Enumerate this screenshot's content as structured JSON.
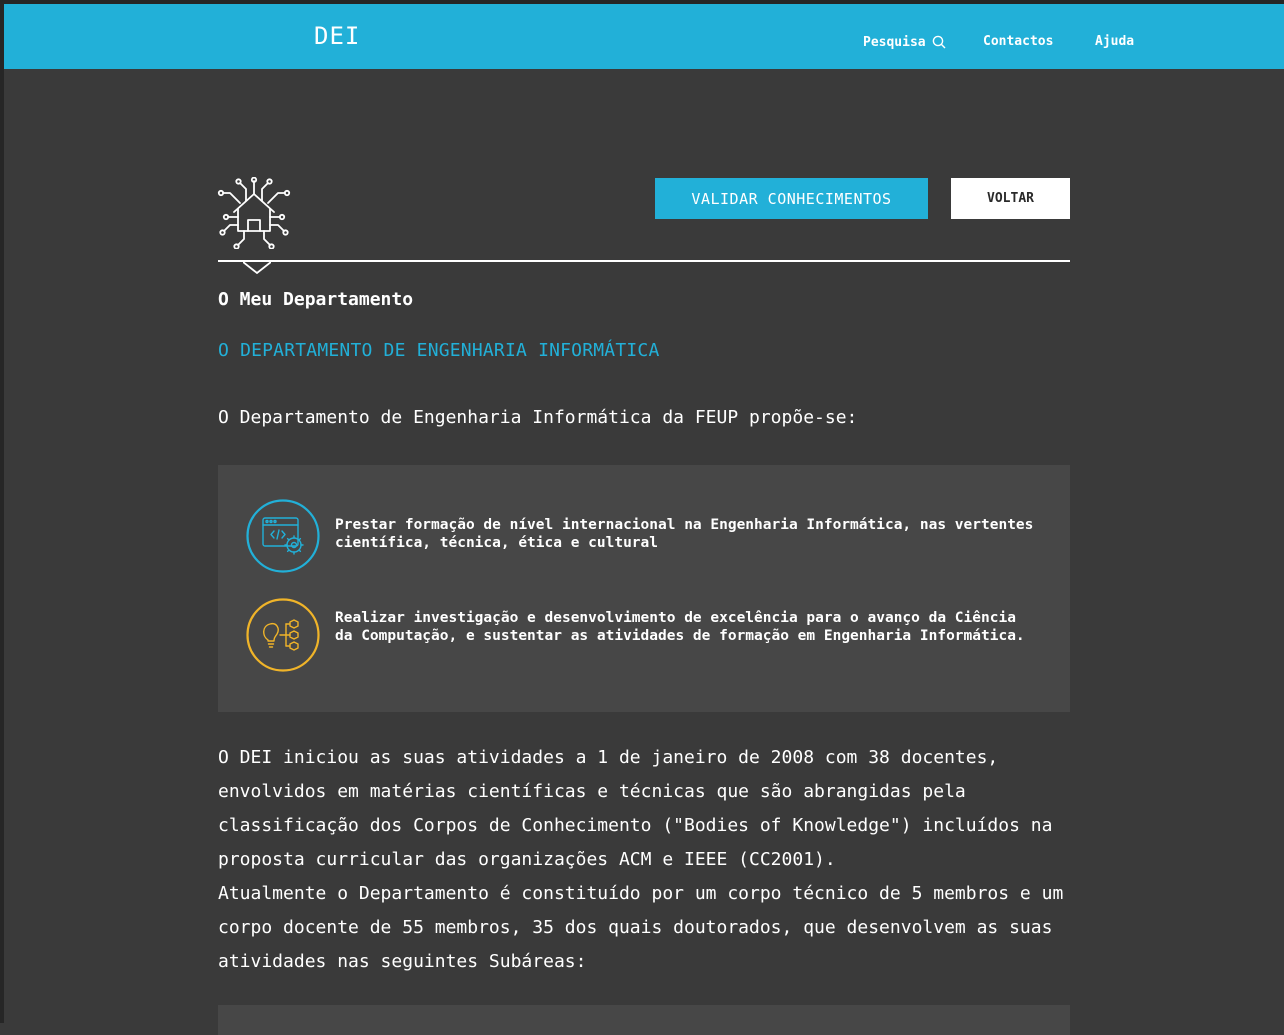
{
  "header": {
    "brand": "DEI",
    "nav": {
      "search_label": "Pesquisa",
      "contacts_label": "Contactos",
      "help_label": "Ajuda"
    }
  },
  "actions": {
    "validate_label": "VALIDAR CONHECIMENTOS",
    "back_label": "VOLTAR"
  },
  "page": {
    "section_title": "O Meu Departamento",
    "dept_heading": "O DEPARTAMENTO DE ENGENHARIA INFORMÁTICA",
    "intro": "O Departamento de Engenharia Informática da FEUP propõe-se:",
    "missions": [
      {
        "icon": "code-settings-icon",
        "text": "Prestar formação de nível internacional na Engenharia Informática, nas vertentes científica, técnica, ética e cultural",
        "color": "#22b0d8"
      },
      {
        "icon": "lightbulb-network-icon",
        "text": "Realizar investigação e desenvolvimento de excelência para o avanço da Ciência da Computação, e sustentar as atividades de formação em Engenharia Informática.",
        "color": "#f0b429"
      }
    ],
    "body_p1": "O DEI iniciou as suas atividades a 1 de janeiro de 2008 com 38 docentes, envolvidos em matérias científicas e técnicas que são abrangidas pela classificação dos Corpos de Conhecimento (\"Bodies of Knowledge\") incluídos na proposta curricular das organizações ACM e IEEE (CC2001).",
    "body_p2": "Atualmente o Departamento é constituído por um corpo técnico de 5 membros e um corpo docente de 55 membros, 35 dos quais doutorados, que desenvolvem as suas atividades nas seguintes Subáreas:"
  },
  "colors": {
    "accent": "#22b0d8",
    "background": "#3a3a3a",
    "panel": "#474747",
    "secondary_accent": "#f0b429"
  }
}
